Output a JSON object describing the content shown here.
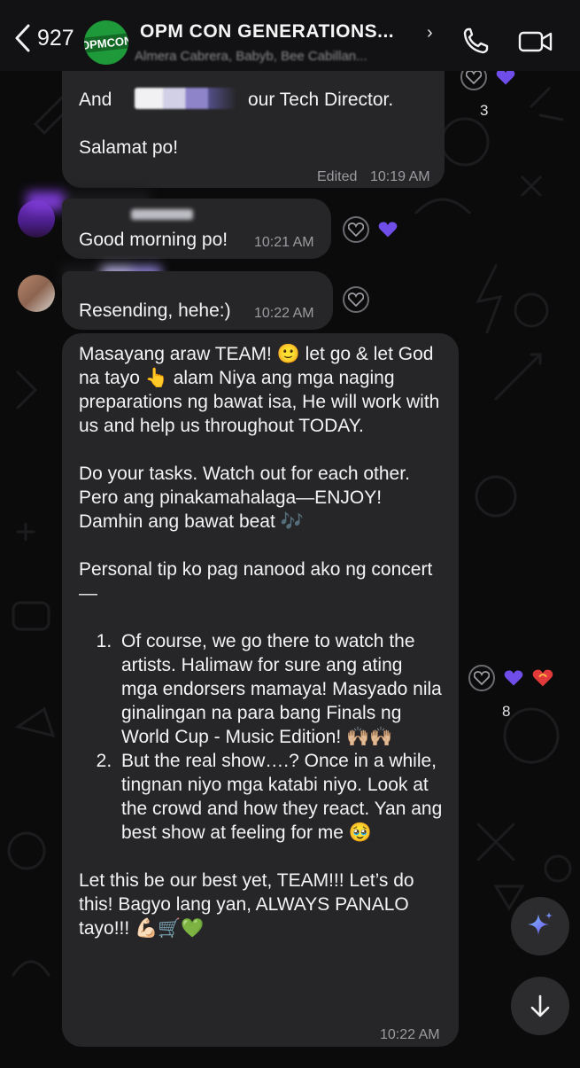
{
  "header": {
    "back_count": "927",
    "logo_text": "OPMCON",
    "group_title": "OPM CON GENERATIONS...",
    "members_preview": "Almera Cabrera, Babyb, Bee Cabillan..."
  },
  "messages": [
    {
      "line1_before": "And",
      "line1_after": "our Tech Director.",
      "line2": "Salamat po!",
      "edited": "Edited",
      "time": "10:19 AM",
      "reaction_count": "3"
    },
    {
      "text": "Good morning po!",
      "time": "10:21 AM"
    },
    {
      "text": "Resending, hehe:)",
      "time": "10:22 AM"
    },
    {
      "p1": "Masayang araw TEAM! 🙂 let go & let God na tayo 👆 alam Niya ang mga naging preparations ng bawat isa, He will work with us and help us throughout TODAY.",
      "p2": "Do your tasks. Watch out for each other. Pero ang pinakamahalaga—ENJOY! Damhin ang bawat beat 🎶",
      "p3": "Personal tip ko pag nanood ako ng concert—",
      "list": [
        "Of course, we go there to watch the artists. Halimaw for sure ang ating mga endorsers mamaya! Masyado nila ginalingan na para bang Finals ng World Cup - Music Edition! 🙌🏼🙌🏼",
        "But the real show….? Once in a while, tingnan niyo mga katabi niyo. Look at the crowd and how they react. Yan ang best show at feeling for me 🥹"
      ],
      "p4": "Let this be our best yet, TEAM!!! Let’s do this! Bagyo lang yan, ALWAYS PANALO tayo!!! 💪🏻🛒💚",
      "time": "10:22 AM",
      "reaction_count": "8"
    }
  ],
  "colors": {
    "background": "#0b0b0c",
    "bubble": "#262628",
    "heart_purple": "#6f4de8"
  }
}
